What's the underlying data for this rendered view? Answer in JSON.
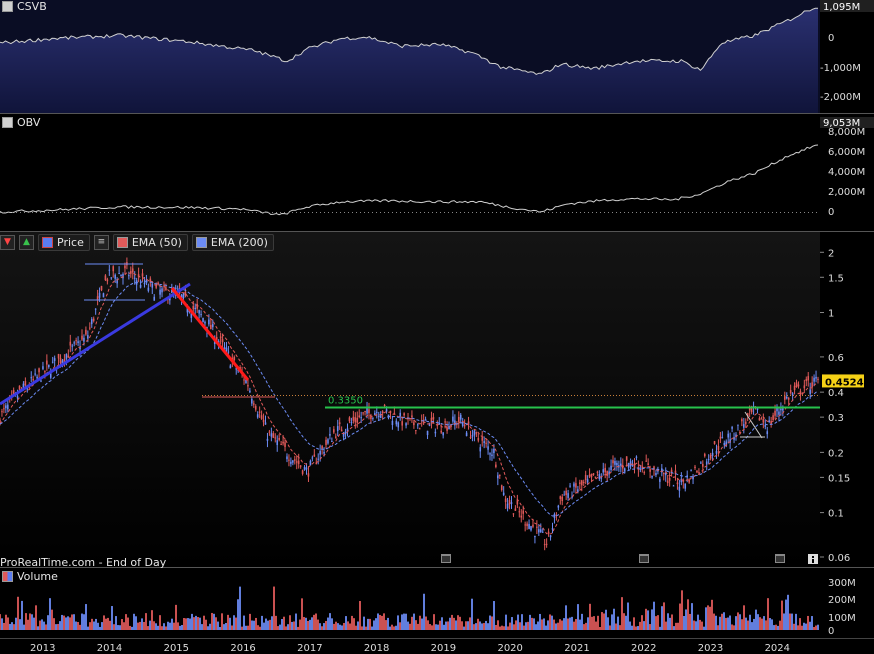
{
  "panels": {
    "csvb": {
      "label": "CSVB",
      "color": "#d0d0d0",
      "last_value": "1,095M",
      "ticks": [
        "0",
        "-1,000M",
        "-2,000M"
      ]
    },
    "obv": {
      "label": "OBV",
      "color": "#d0d0d0",
      "last_value": "9,053M",
      "ticks": [
        "8,000M",
        "6,000M",
        "4,000M",
        "2,000M",
        "0"
      ]
    },
    "price": {
      "toolbar_icons": [
        "sell-arrow-icon",
        "buy-arrow-icon"
      ],
      "legend": [
        {
          "label": "Price",
          "color": "#5b7cf0"
        },
        {
          "label": "EMA (50)",
          "color": "#e05a5a"
        },
        {
          "label": "EMA (200)",
          "color": "#6c8cf5"
        }
      ],
      "last_price": "0.4524",
      "level_label": "0.3350",
      "level_color": "#27c24c",
      "ticks": [
        "2",
        "1.5",
        "1",
        "0.6",
        "0.4",
        "0.3",
        "0.2",
        "0.15",
        "0.1",
        "0.06"
      ]
    },
    "volume": {
      "label": "Volume",
      "ticks": [
        "300M",
        "200M",
        "100M",
        "0"
      ]
    }
  },
  "x_axis": {
    "years": [
      "2013",
      "2014",
      "2015",
      "2016",
      "2017",
      "2018",
      "2019",
      "2020",
      "2021",
      "2022",
      "2023",
      "2024"
    ]
  },
  "footer": {
    "source": "ProRealTime.com - End of Day"
  },
  "chart_data": {
    "type": "line",
    "y_scale": "log",
    "x": [
      "2012.7",
      "2013.0",
      "2013.5",
      "2014.0",
      "2014.3",
      "2014.6",
      "2015.0",
      "2015.4",
      "2015.8",
      "2016.2",
      "2016.4",
      "2016.7",
      "2017.0",
      "2017.3",
      "2017.7",
      "2018.1",
      "2018.4",
      "2018.8",
      "2019.3",
      "2019.6",
      "2019.8",
      "2020.1",
      "2020.25",
      "2020.6",
      "2020.9",
      "2021.1",
      "2021.5",
      "2021.9",
      "2022.2",
      "2022.5",
      "2022.9",
      "2023.1",
      "2023.4",
      "2023.8",
      "2024.0",
      "2024.2",
      "2024.5",
      "2024.9"
    ],
    "series": [
      {
        "values": [
          0.3,
          0.4,
          0.55,
          0.75,
          1.5,
          1.6,
          1.3,
          1.2,
          0.9,
          0.55,
          0.45,
          0.25,
          0.2,
          0.16,
          0.25,
          0.3,
          0.33,
          0.28,
          0.27,
          0.29,
          0.24,
          0.2,
          0.12,
          0.09,
          0.07,
          0.12,
          0.14,
          0.17,
          0.18,
          0.16,
          0.14,
          0.16,
          0.21,
          0.27,
          0.32,
          0.27,
          0.38,
          0.45
        ]
      }
    ],
    "horizontal_levels": [
      0.335,
      0.385
    ],
    "ylim": [
      0.06,
      2.2
    ]
  }
}
